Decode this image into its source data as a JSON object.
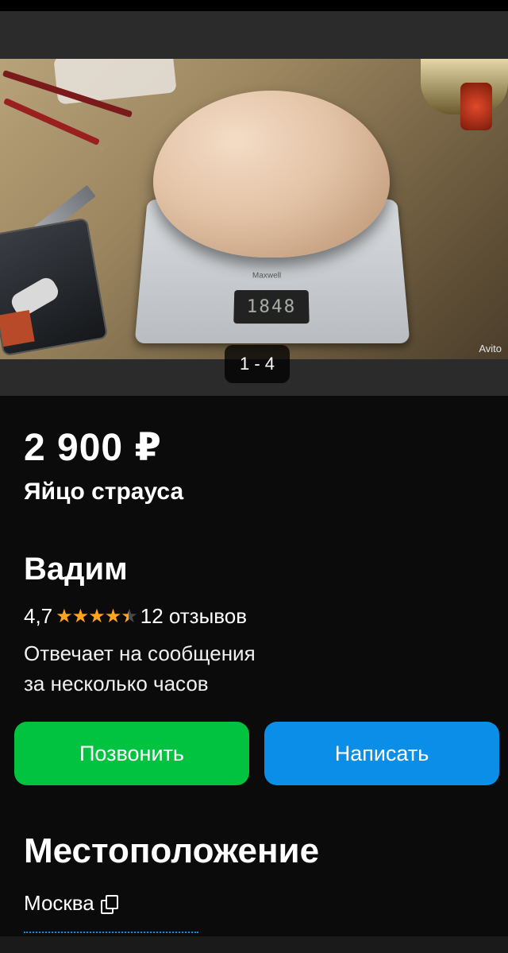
{
  "gallery": {
    "counter": "1 - 4",
    "watermark": "Avito",
    "scale_brand": "Maxwell",
    "scale_reading": "1848"
  },
  "listing": {
    "price": "2 900 ₽",
    "title": "Яйцо страуса"
  },
  "seller": {
    "name": "Вадим",
    "rating": "4,7",
    "rating_value": 4.7,
    "reviews": "12 отзывов",
    "response_line1": "Отвечает на сообщения",
    "response_line2": "за несколько часов"
  },
  "actions": {
    "call_label": "Позвонить",
    "write_label": "Написать"
  },
  "location": {
    "heading": "Местоположение",
    "city": "Москва"
  },
  "colors": {
    "call_button": "#02c33f",
    "write_button": "#0a8ee8",
    "star": "#ffa41b",
    "background": "#0b0b0b"
  }
}
